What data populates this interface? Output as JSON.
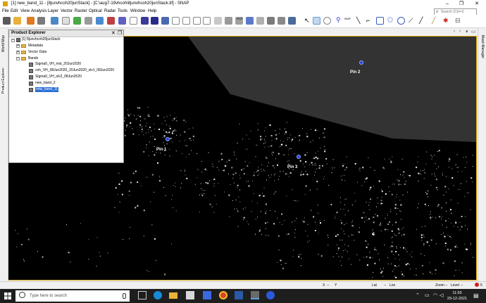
{
  "window": {
    "title": "[1] new_band_11 - [8junvhcoh20junStack] - [C:\\aug7-19vhcoh\\8junvhcoh20junStack.tif] - SNAP",
    "min": "–",
    "max": "❐",
    "close": "✕"
  },
  "menu": {
    "items": [
      "File",
      "Edit",
      "View",
      "Analysis",
      "Layer",
      "Vector",
      "Raster",
      "Optical",
      "Radar",
      "Tools",
      "Window",
      "Help"
    ],
    "search_placeholder": "Search (Ctrl+I)"
  },
  "toolbar": {
    "gcp_label_1": "GCP",
    "gcp_label_2": "GCP"
  },
  "side_tabs": {
    "world_map": "World Map",
    "product_explorer": "Product Explorer",
    "mask_manager": "Mask Manager"
  },
  "product_explorer": {
    "title": "Product Explorer",
    "product": "[1] 8junvhcoh20junStack",
    "folders": [
      "Metadata",
      "Vector Data",
      "Bands"
    ],
    "bands": [
      "Sigma0_VH_mst_20Jun2020",
      "coh_VH_08Jun2020_20Jun2020_slv1_08Jun2020",
      "Sigma0_VH_slv2_08Jun2020",
      "new_band_2",
      "new_band_11"
    ]
  },
  "pins": [
    "Pin 1",
    "Pin 2",
    "Pin 3"
  ],
  "status": {
    "x": "X",
    "y": "Y",
    "x_sep": "--",
    "lat": "Lat",
    "lat_sep": "--",
    "lon": "Lon",
    "zoom": "Zoom",
    "zoom_sep": "--",
    "level": "Level",
    "level_sep": "--"
  },
  "taskbar": {
    "search_placeholder": "Type here to search",
    "time": "11:55",
    "date": "29-12-2021",
    "notif_count": "5"
  },
  "colors": {
    "accent_frame": "#d9a300",
    "selection": "#2b6fd6",
    "pin": "#2442d8"
  }
}
